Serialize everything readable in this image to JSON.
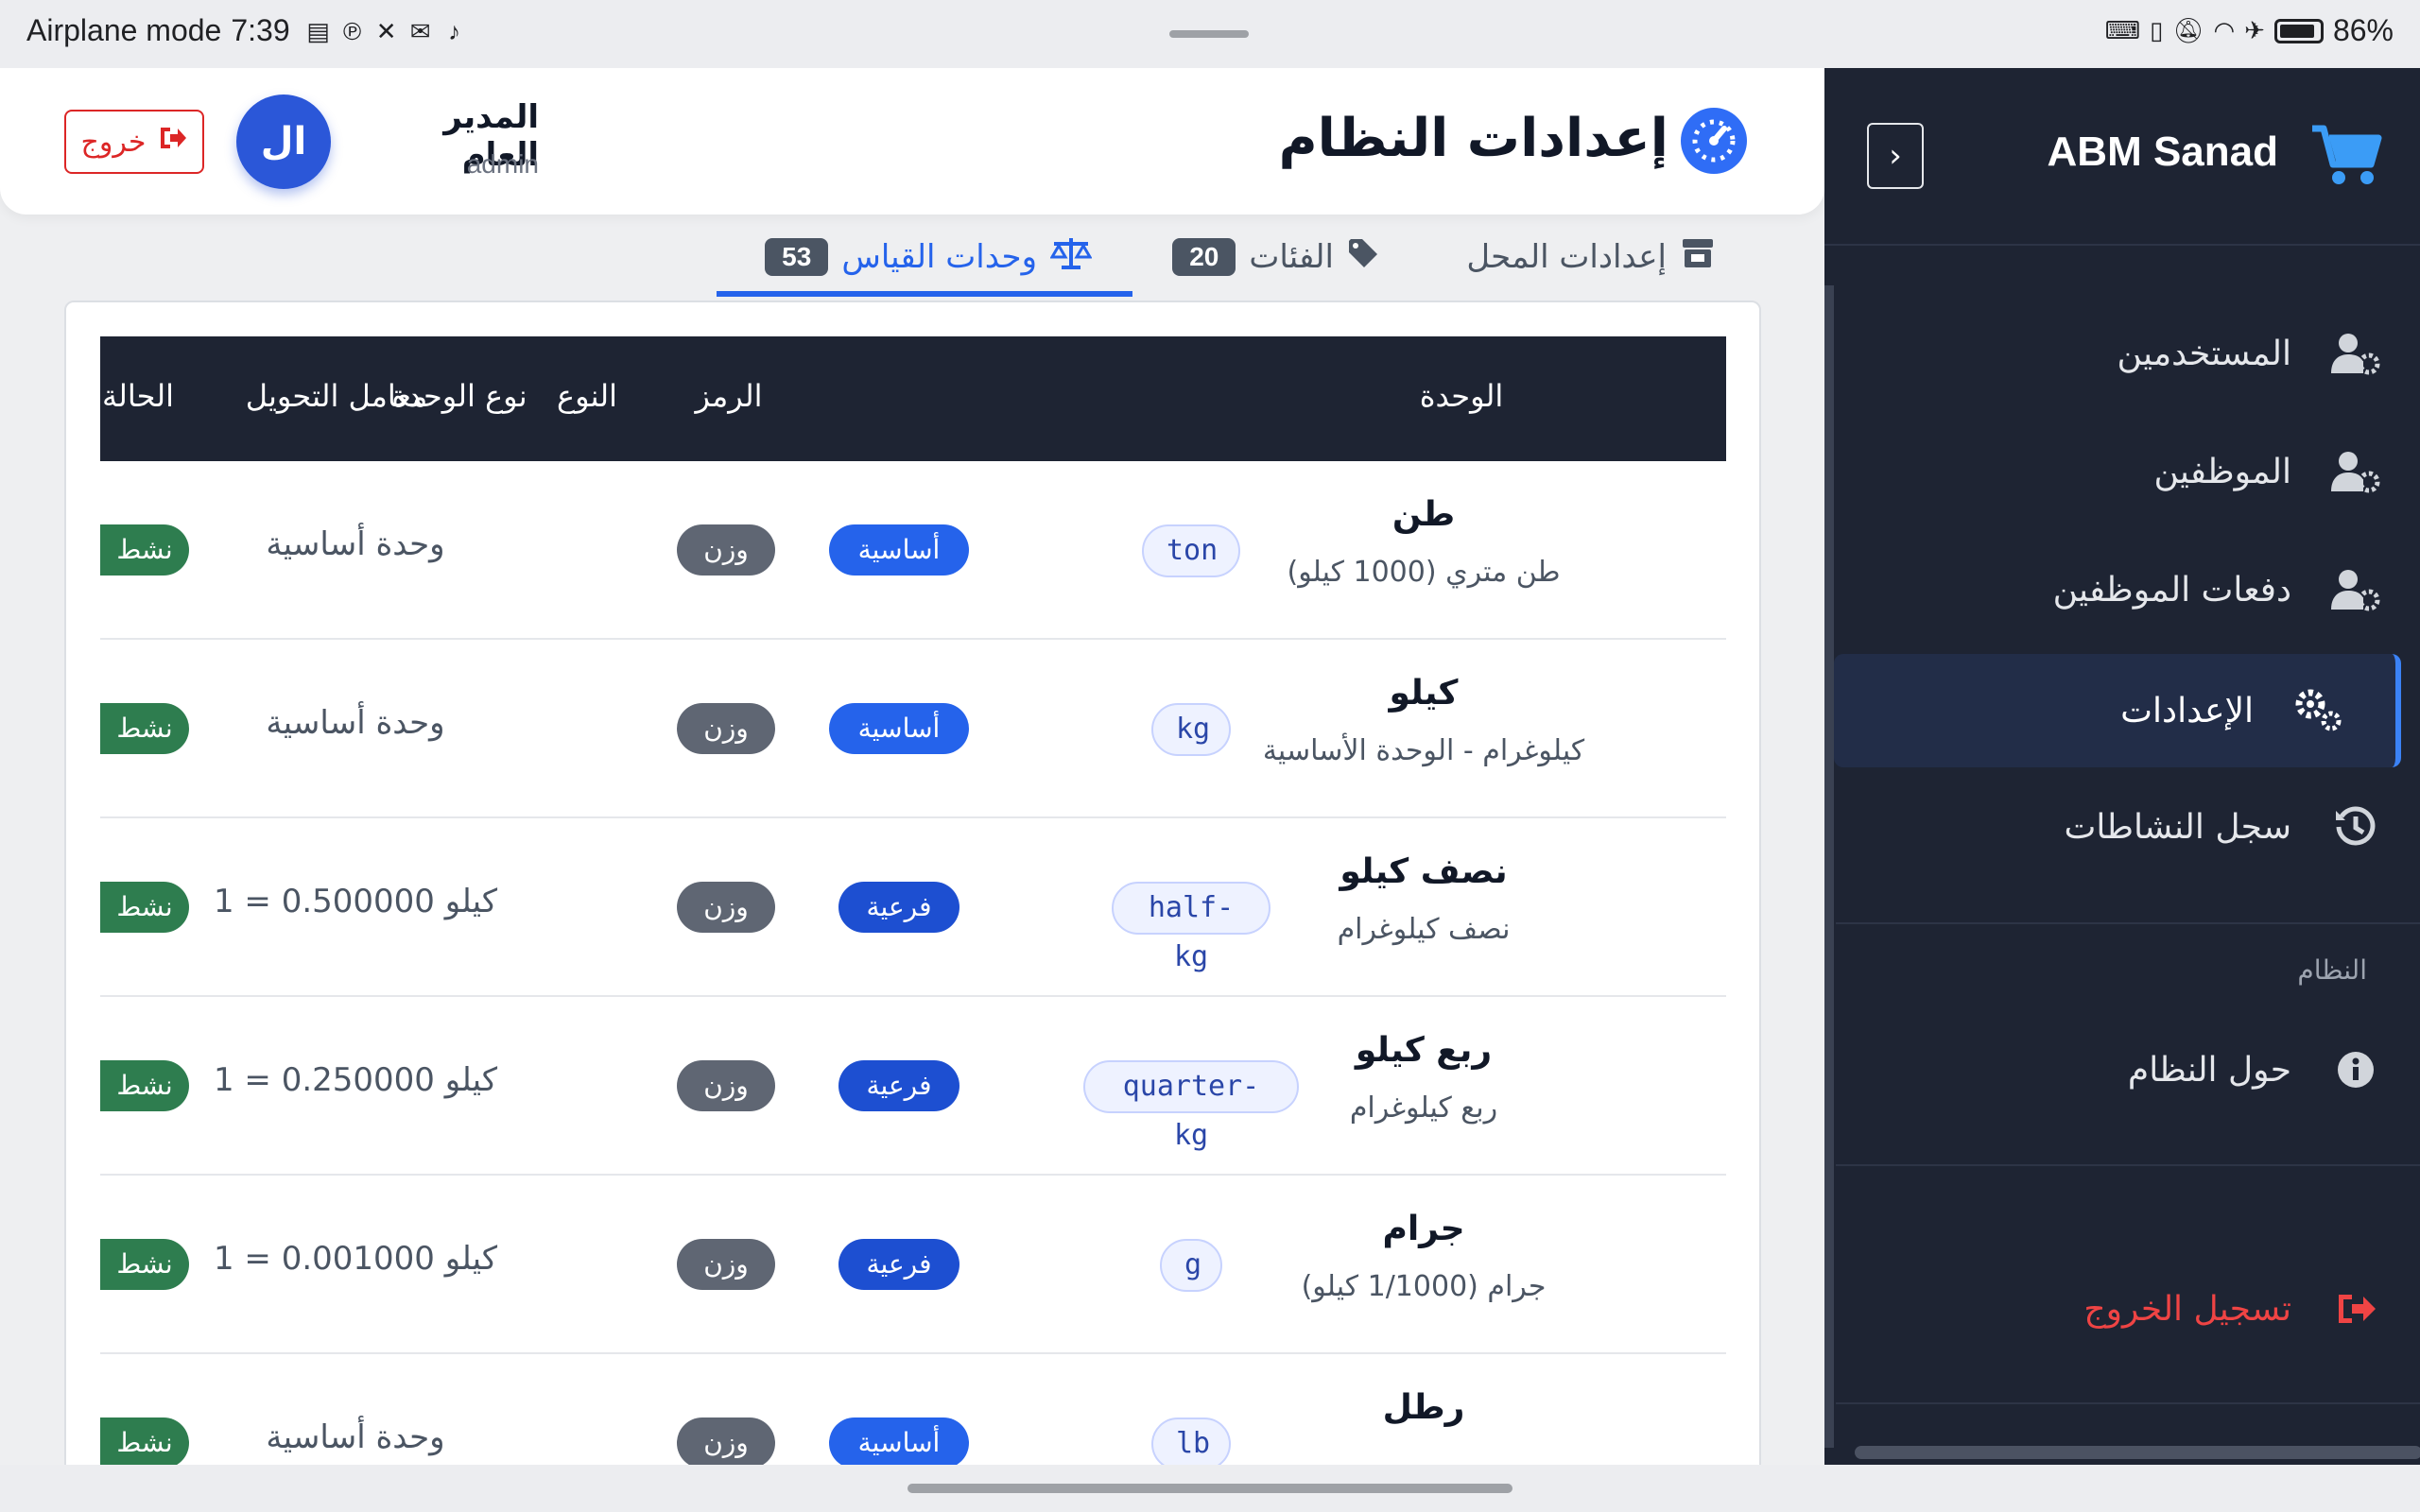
{
  "status_bar": {
    "mode": "Airplane mode",
    "time": "7:39",
    "battery": "86%",
    "left_icons": [
      "pdf-icon",
      "pinterest-icon",
      "x-icon",
      "mail-icon",
      "tiktok-icon"
    ],
    "right_icons": [
      "keyboard-icon",
      "vibrate-icon",
      "mute-icon",
      "wifi-icon",
      "airplane-icon",
      "battery-icon"
    ]
  },
  "sidebar": {
    "brand": "ABM Sanad",
    "toggle_symbol": "›",
    "items": [
      {
        "label": "المستخدمين",
        "icon": "users-gear-icon"
      },
      {
        "label": "الموظفين",
        "icon": "user-gear-icon"
      },
      {
        "label": "دفعات الموظفين",
        "icon": "user-gear-icon"
      },
      {
        "label": "الإعدادات",
        "icon": "gears-icon",
        "active": true
      },
      {
        "label": "سجل النشاطات",
        "icon": "history-icon"
      }
    ],
    "section_system": "النظام",
    "about": "حول النظام",
    "logout": "تسجيل الخروج",
    "accent_color": "#3b82f6",
    "bg_color": "#1e2433"
  },
  "header": {
    "title": "إعدادات النظام",
    "user_name": "المدير العام",
    "user_role": "admin",
    "avatar_initials": "ال",
    "exit_label": "خروج"
  },
  "tabs": [
    {
      "label": "إعدادات المحل",
      "icon": "store-icon"
    },
    {
      "label": "الفئات",
      "count": "20",
      "icon": "tags-icon"
    },
    {
      "label": "وحدات القياس",
      "count": "53",
      "icon": "scale-icon",
      "active": true
    }
  ],
  "table": {
    "headers": {
      "unit": "الوحدة",
      "code": "الرمز",
      "type": "النوع",
      "unit_type": "نوع الوحدة",
      "factor": "معامل التحويل",
      "status": "الحالة"
    },
    "rows": [
      {
        "name": "طن",
        "desc": "طن متري (1000 كيلو)",
        "code": "ton",
        "type": "أساسية",
        "type_kind": "basic",
        "unit_type": "وزن",
        "factor": "وحدة أساسية",
        "status": "نشط"
      },
      {
        "name": "كيلو",
        "desc": "كيلوغرام - الوحدة الأساسية",
        "code": "kg",
        "type": "أساسية",
        "type_kind": "basic",
        "unit_type": "وزن",
        "factor": "وحدة أساسية",
        "status": "نشط"
      },
      {
        "name": "نصف كيلو",
        "desc": "نصف كيلوغرام",
        "code": "half-kg",
        "type": "فرعية",
        "type_kind": "sub",
        "unit_type": "وزن",
        "factor": "1 = 0.500000 كيلو",
        "status": "نشط"
      },
      {
        "name": "ربع كيلو",
        "desc": "ربع كيلوغرام",
        "code": "quarter-kg",
        "type": "فرعية",
        "type_kind": "sub",
        "unit_type": "وزن",
        "factor": "1 = 0.250000 كيلو",
        "status": "نشط"
      },
      {
        "name": "جرام",
        "desc": "جرام (1/1000 كيلو)",
        "code": "g",
        "type": "فرعية",
        "type_kind": "sub",
        "unit_type": "وزن",
        "factor": "1 = 0.001000 كيلو",
        "status": "نشط"
      },
      {
        "name": "رطل",
        "desc": "",
        "code": "lb",
        "type": "أساسية",
        "type_kind": "basic",
        "unit_type": "وزن",
        "factor": "وحدة أساسية",
        "status": "نشط"
      }
    ]
  }
}
